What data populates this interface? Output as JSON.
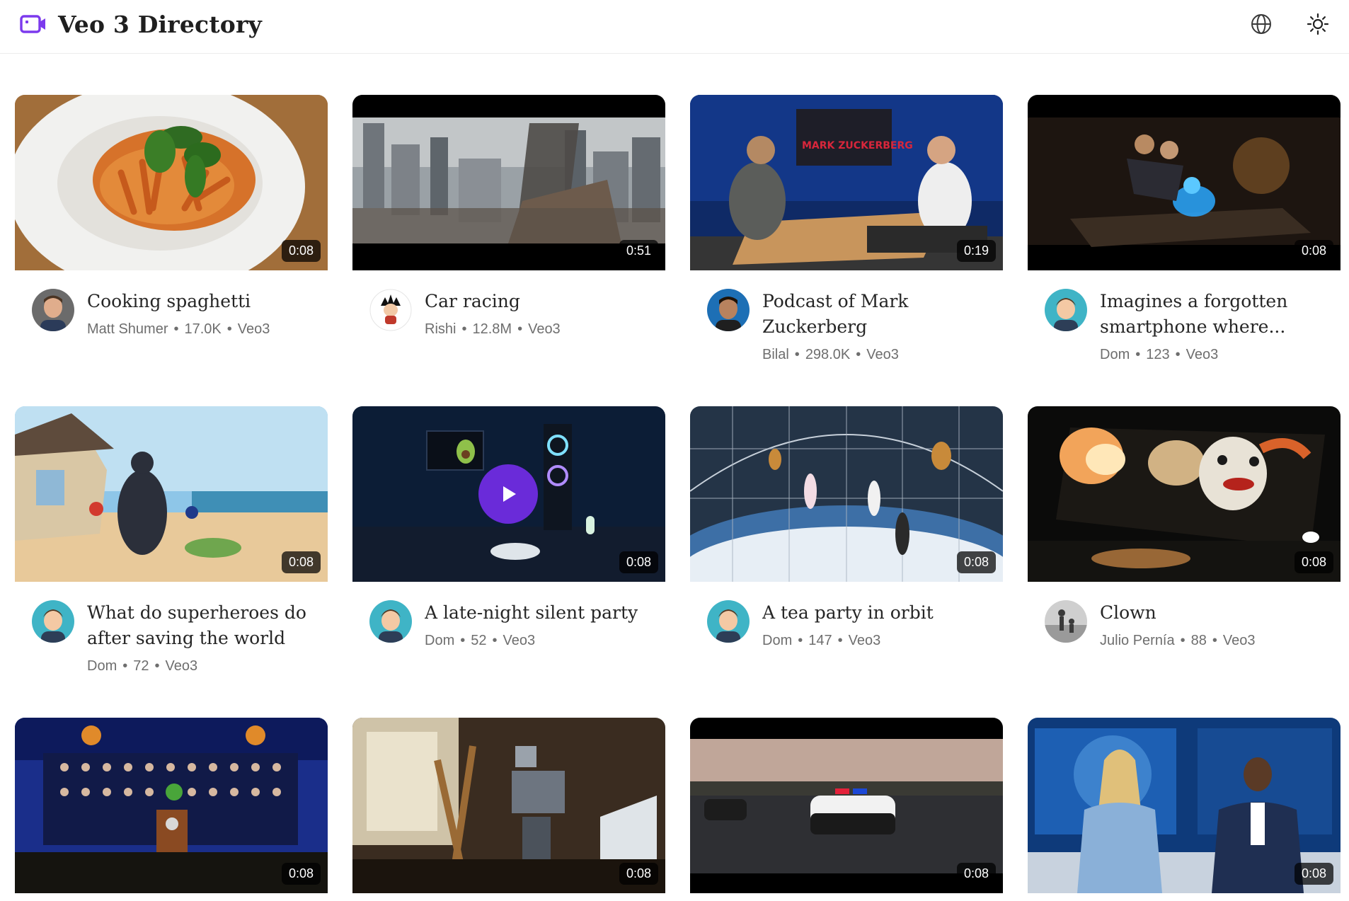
{
  "app": {
    "title": "Veo 3 Directory",
    "brand_color": "#7c3aed",
    "header_icons": [
      "globe-icon",
      "sun-icon"
    ]
  },
  "videos": [
    {
      "title": "Cooking spaghetti",
      "author": "Matt Shumer",
      "views": "17.0K",
      "model": "Veo3",
      "duration": "0:08"
    },
    {
      "title": "Car racing",
      "author": "Rishi",
      "views": "12.8M",
      "model": "Veo3",
      "duration": "0:51"
    },
    {
      "title": "Podcast of Mark Zuckerberg",
      "author": "Bilal",
      "views": "298.0K",
      "model": "Veo3",
      "duration": "0:19",
      "overlay_text": "MARK ZUCKERBERG"
    },
    {
      "title": "Imagines a forgotten smartphone where...",
      "author": "Dom",
      "views": "123",
      "model": "Veo3",
      "duration": "0:08"
    },
    {
      "title": "What do superheroes do after saving the world",
      "author": "Dom",
      "views": "72",
      "model": "Veo3",
      "duration": "0:08"
    },
    {
      "title": "A late-night silent party",
      "author": "Dom",
      "views": "52",
      "model": "Veo3",
      "duration": "0:08"
    },
    {
      "title": "A tea party in orbit",
      "author": "Dom",
      "views": "147",
      "model": "Veo3",
      "duration": "0:08"
    },
    {
      "title": "Clown",
      "author": "Julio Pernía",
      "views": "88",
      "model": "Veo3",
      "duration": "0:08"
    },
    {
      "title": "",
      "author": "",
      "views": "",
      "model": "",
      "duration": "0:08"
    },
    {
      "title": "",
      "author": "",
      "views": "",
      "model": "",
      "duration": "0:08"
    },
    {
      "title": "",
      "author": "",
      "views": "",
      "model": "",
      "duration": "0:08"
    },
    {
      "title": "",
      "author": "",
      "views": "",
      "model": "",
      "duration": "0:08"
    }
  ]
}
